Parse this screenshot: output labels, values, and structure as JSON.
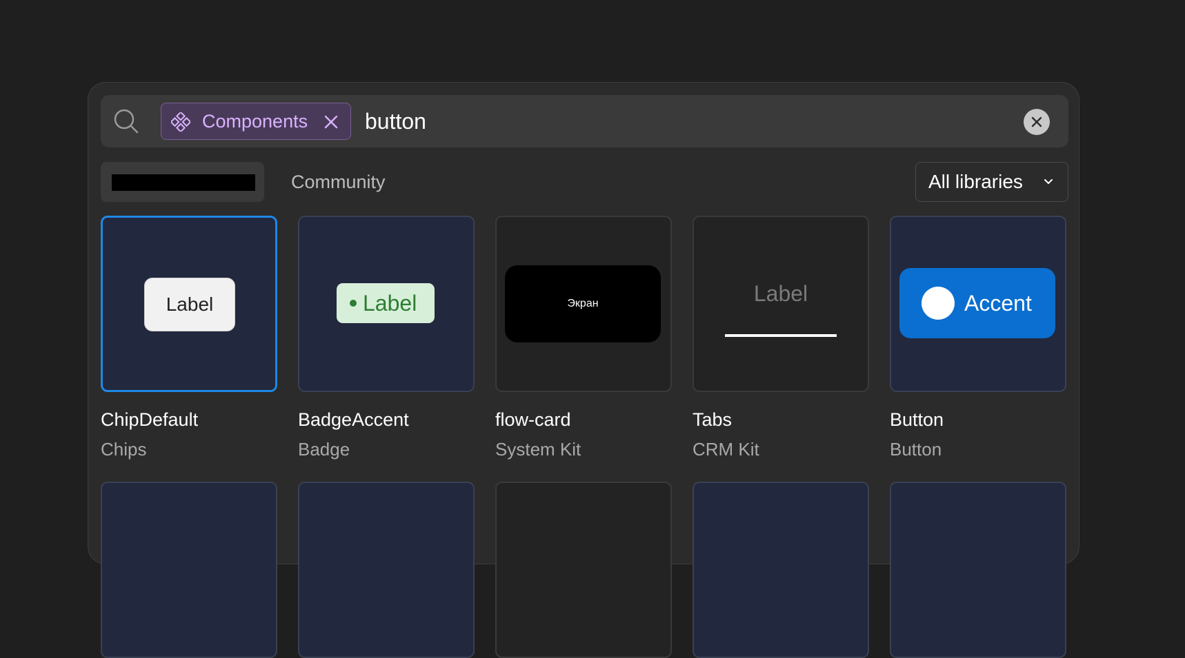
{
  "search": {
    "filter_chip": "Components",
    "query": "button"
  },
  "scope_tabs": {
    "community": "Community"
  },
  "library_select": {
    "value": "All libraries"
  },
  "results": [
    {
      "title": "ChipDefault",
      "subtitle": "Chips",
      "preview_text": "Label"
    },
    {
      "title": "BadgeAccent",
      "subtitle": "Badge",
      "preview_text": "Label"
    },
    {
      "title": "flow-card",
      "subtitle": "System Kit",
      "preview_text": "Экран"
    },
    {
      "title": "Tabs",
      "subtitle": "CRM Kit",
      "preview_text": "Label"
    },
    {
      "title": "Button",
      "subtitle": "Button",
      "preview_text": "Accent"
    }
  ],
  "colors": {
    "chip_accent": "#d9b3ff",
    "selection": "#1e88e5",
    "button_accent": "#0a6fd0",
    "badge_green": "#2e7d32"
  }
}
